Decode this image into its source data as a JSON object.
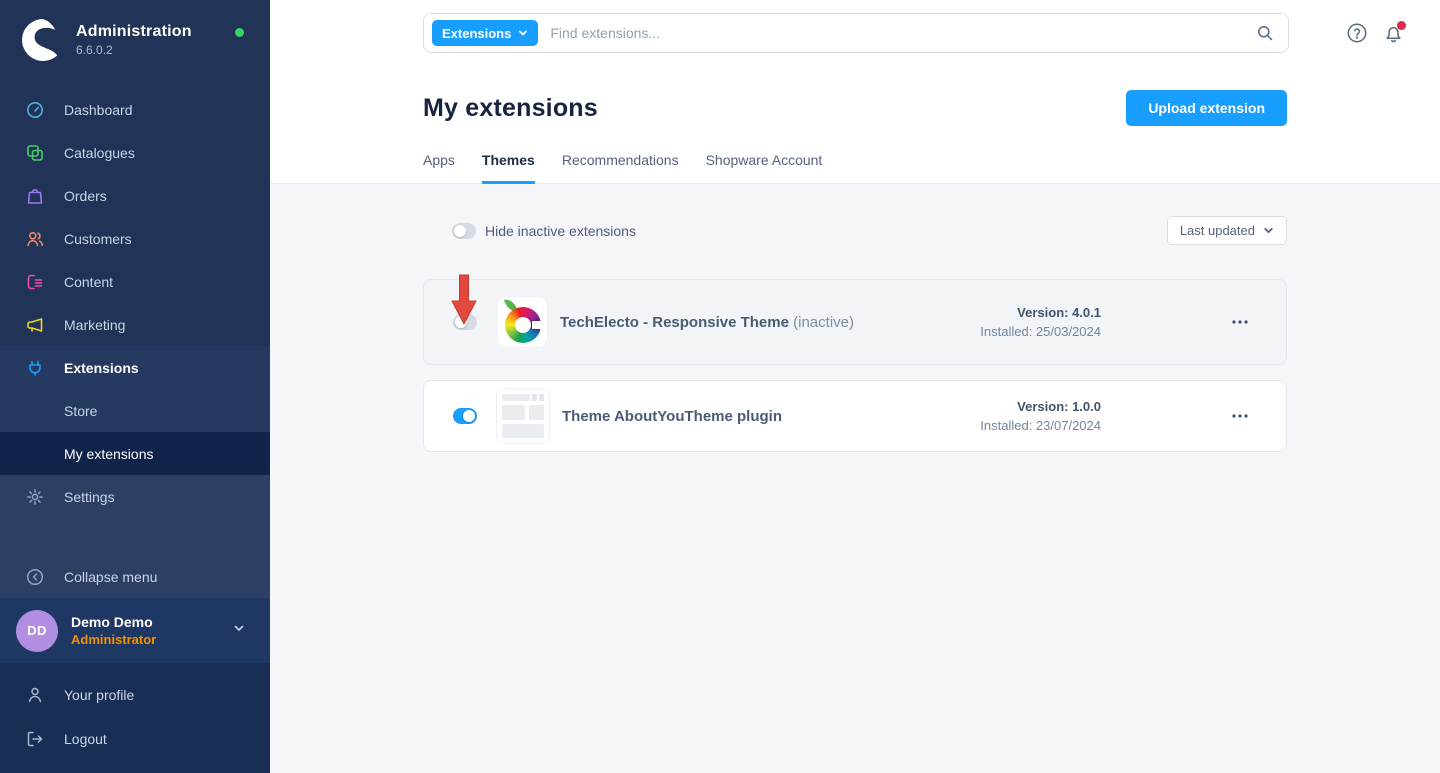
{
  "app": {
    "name": "Administration",
    "version": "6.6.0.2"
  },
  "colors": {
    "accent": "#189eff",
    "sidebar_bg": "#213457",
    "annotation_arrow": "#e2483d",
    "role_orange": "#f29100",
    "avatar_purple": "#b18ee2",
    "online_green": "#37d463",
    "notification_red": "#de294c"
  },
  "topbar": {
    "scope_label": "Extensions",
    "search_placeholder": "Find extensions...",
    "icons": [
      "search-icon",
      "help-icon",
      "notification-bell-icon"
    ]
  },
  "sidebar": {
    "items": [
      {
        "label": "Dashboard",
        "icon": "dashboard-icon",
        "color": "#51b1e0"
      },
      {
        "label": "Catalogues",
        "icon": "catalogues-icon",
        "color": "#41cf63"
      },
      {
        "label": "Orders",
        "icon": "orders-icon",
        "color": "#9b7af0"
      },
      {
        "label": "Customers",
        "icon": "customers-icon",
        "color": "#f0876a"
      },
      {
        "label": "Content",
        "icon": "content-icon",
        "color": "#f14db0"
      },
      {
        "label": "Marketing",
        "icon": "marketing-icon",
        "color": "#f0d623"
      }
    ],
    "extensions": {
      "label": "Extensions",
      "icon": "extensions-plug-icon",
      "color": "#189eff",
      "children": [
        {
          "label": "Store",
          "selected": false
        },
        {
          "label": "My extensions",
          "selected": true
        }
      ]
    },
    "settings_label": "Settings",
    "collapse_label": "Collapse menu",
    "user": {
      "initials": "DD",
      "name": "Demo Demo",
      "role": "Administrator"
    },
    "footer": [
      {
        "label": "Your profile",
        "icon": "person-icon"
      },
      {
        "label": "Logout",
        "icon": "logout-icon"
      }
    ]
  },
  "header": {
    "title": "My extensions",
    "upload_button": "Upload extension"
  },
  "tabs": [
    {
      "label": "Apps",
      "active": false
    },
    {
      "label": "Themes",
      "active": true
    },
    {
      "label": "Recommendations",
      "active": false
    },
    {
      "label": "Shopware Account",
      "active": false
    }
  ],
  "controls": {
    "hide_toggle_label": "Hide inactive extensions",
    "hide_toggle_state": "off",
    "sort_label": "Last updated"
  },
  "extensions": [
    {
      "name": "TechElecto - Responsive Theme",
      "status_suffix": "(inactive)",
      "version_label": "Version: 4.0.1",
      "installed_label": "Installed: 25/03/2024",
      "active": false,
      "annotation": "red-arrow-pointing-to-toggle"
    },
    {
      "name": "Theme AboutYouTheme plugin",
      "status_suffix": "",
      "version_label": "Version: 1.0.0",
      "installed_label": "Installed: 23/07/2024",
      "active": true,
      "annotation": ""
    }
  ]
}
